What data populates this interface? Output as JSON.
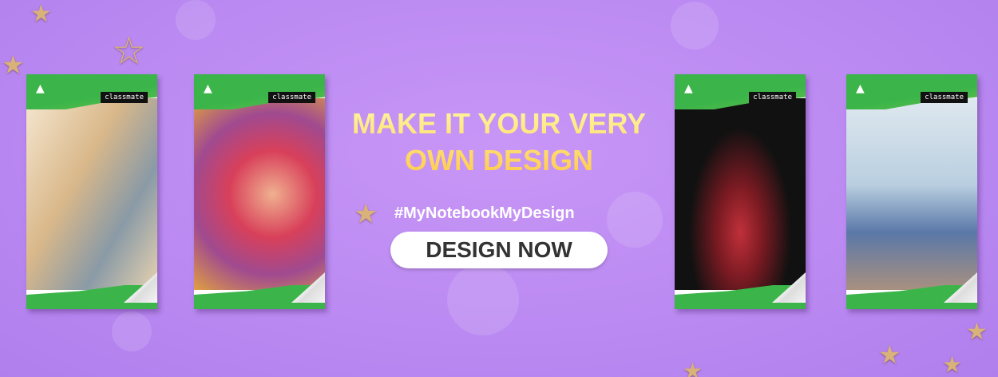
{
  "headline": {
    "line1": "MAKE IT YOUR VERY",
    "line2": "OWN DESIGN"
  },
  "hashtag": "#MyNotebookMyDesign",
  "cta": {
    "label": "DESIGN NOW"
  },
  "notebooks": [
    {
      "brand": "classmate",
      "logo": "ITC"
    },
    {
      "brand": "classmate",
      "logo": "ITC"
    },
    {
      "brand": "classmate",
      "logo": "ITC"
    },
    {
      "brand": "classmate",
      "logo": "ITC"
    }
  ],
  "colors": {
    "background": "#bb8af2",
    "headline": "#ffd85a",
    "cover_green": "#3bb54a",
    "button": "#ffffff",
    "button_text": "#333333"
  }
}
